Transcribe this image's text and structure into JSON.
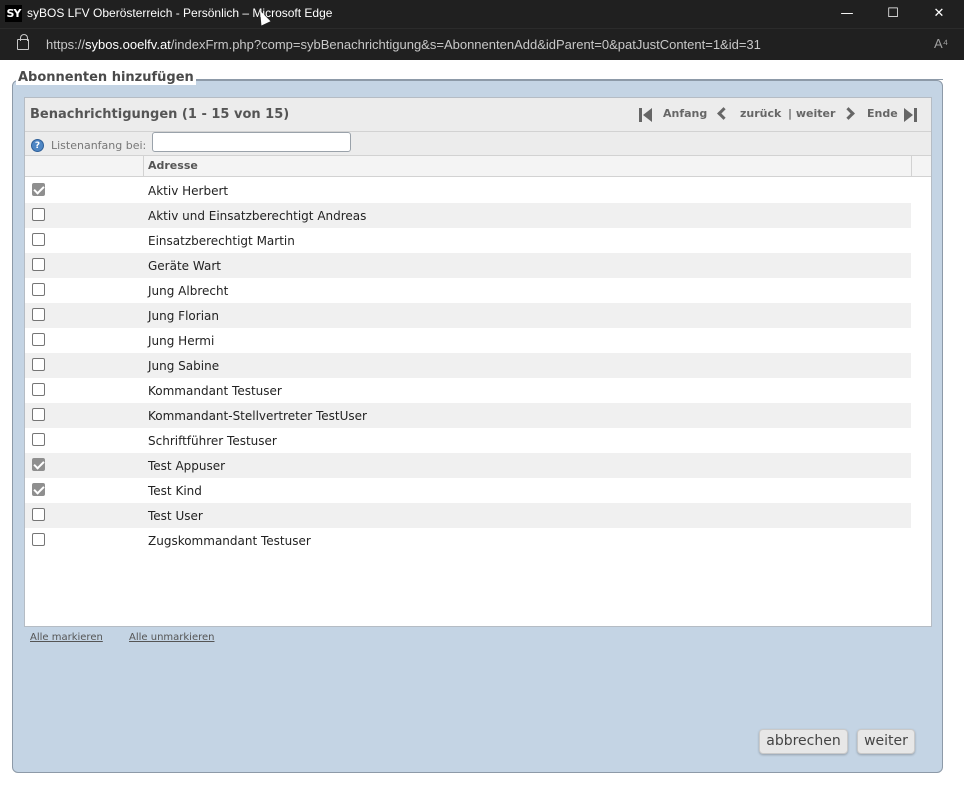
{
  "window": {
    "app_icon_text": "SY",
    "title": "syBOS LFV Oberösterreich - Persönlich – Microsoft Edge",
    "minimize_glyph": "—",
    "maximize_glyph": "☐",
    "close_glyph": "✕"
  },
  "addressbar": {
    "url_prefix": "https://",
    "url_host": "sybos.ooelfv.at",
    "url_path": "/indexFrm.php?comp=sybBenachrichtigung&s=AbonnentenAdd&idParent=0&patJustContent=1&id=31",
    "read_aloud_icon": "A⁴"
  },
  "fieldset": {
    "legend": "Abonnenten hinzufügen"
  },
  "list": {
    "title": "Benachrichtigungen (1 - 15 von 15)",
    "pager": {
      "first": "Anfang",
      "prev": "zurück",
      "next": "| weiter",
      "last": "Ende"
    },
    "filter": {
      "help_glyph": "?",
      "label": "Listenanfang bei:",
      "value": ""
    },
    "column": "Adresse",
    "rows": [
      {
        "label": "Aktiv Herbert",
        "checked": true
      },
      {
        "label": "Aktiv und Einsatzberechtigt Andreas",
        "checked": false
      },
      {
        "label": "Einsatzberechtigt Martin",
        "checked": false
      },
      {
        "label": "Geräte Wart",
        "checked": false
      },
      {
        "label": "Jung Albrecht",
        "checked": false
      },
      {
        "label": "Jung Florian",
        "checked": false
      },
      {
        "label": "Jung Hermi",
        "checked": false
      },
      {
        "label": "Jung Sabine",
        "checked": false
      },
      {
        "label": "Kommandant Testuser",
        "checked": false
      },
      {
        "label": "Kommandant-Stellvertreter TestUser",
        "checked": false
      },
      {
        "label": "Schriftführer Testuser",
        "checked": false
      },
      {
        "label": "Test Appuser",
        "checked": true
      },
      {
        "label": "Test Kind",
        "checked": true
      },
      {
        "label": "Test User",
        "checked": false
      },
      {
        "label": "Zugskommandant Testuser",
        "checked": false
      }
    ]
  },
  "actions": {
    "select_all": "Alle markieren",
    "deselect_all": "Alle unmarkieren",
    "cancel": "abbrechen",
    "next": "weiter"
  }
}
